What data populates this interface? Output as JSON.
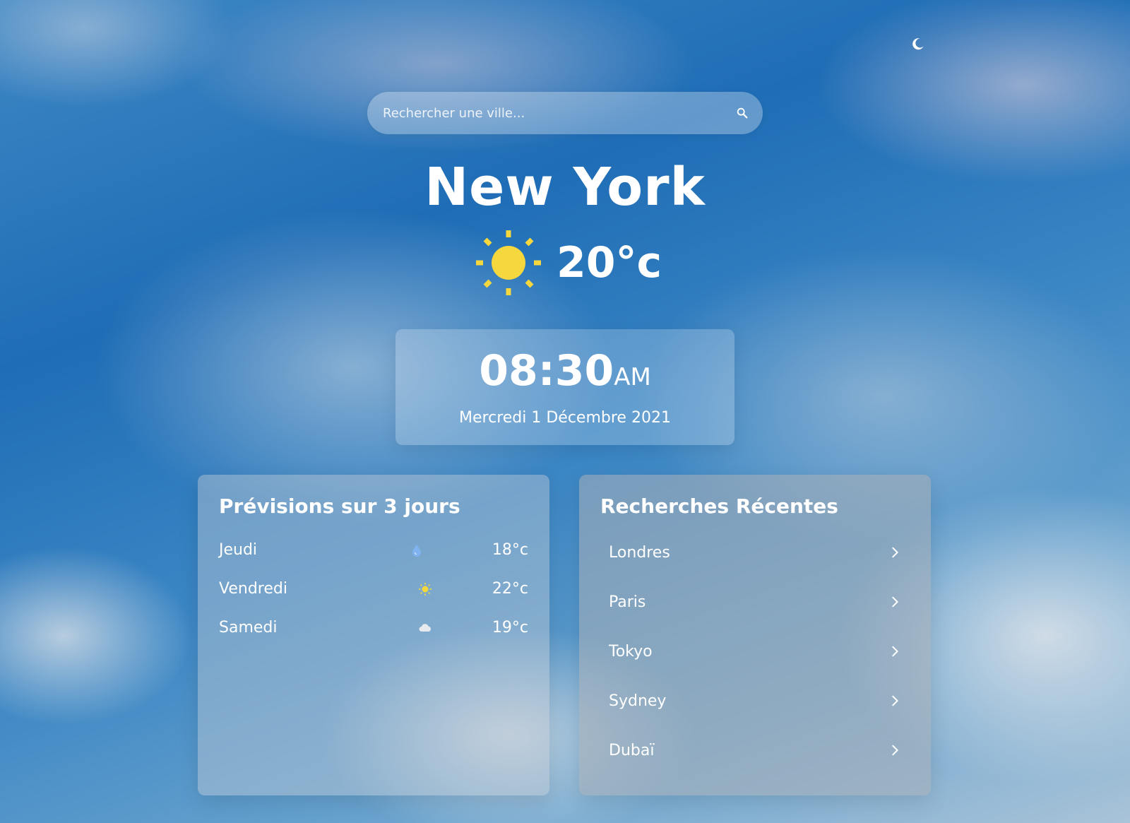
{
  "theme_toggle": {
    "icon": "moon-icon"
  },
  "search": {
    "placeholder": "Rechercher une ville...",
    "icon": "search-icon"
  },
  "current": {
    "city": "New York",
    "condition_icon": "sun-icon",
    "temperature": "20°c"
  },
  "clock": {
    "time": "08:30",
    "period": "AM",
    "date": "Mercredi 1 Décembre 2021"
  },
  "forecast": {
    "title": "Prévisions sur 3 jours",
    "days": [
      {
        "day": "Jeudi",
        "icon": "raindrop-icon",
        "temp": "18°c"
      },
      {
        "day": "Vendredi",
        "icon": "sun-icon",
        "temp": "22°c"
      },
      {
        "day": "Samedi",
        "icon": "cloud-icon",
        "temp": "19°c"
      }
    ]
  },
  "recent": {
    "title": "Recherches Récentes",
    "items": [
      {
        "city": "Londres"
      },
      {
        "city": "Paris"
      },
      {
        "city": "Tokyo"
      },
      {
        "city": "Sydney"
      },
      {
        "city": "Dubaï"
      }
    ]
  },
  "colors": {
    "sun": "#f7d73e",
    "raindrop": "#7fb2ef",
    "cloud": "#e6e9ee",
    "text": "#ffffff"
  }
}
